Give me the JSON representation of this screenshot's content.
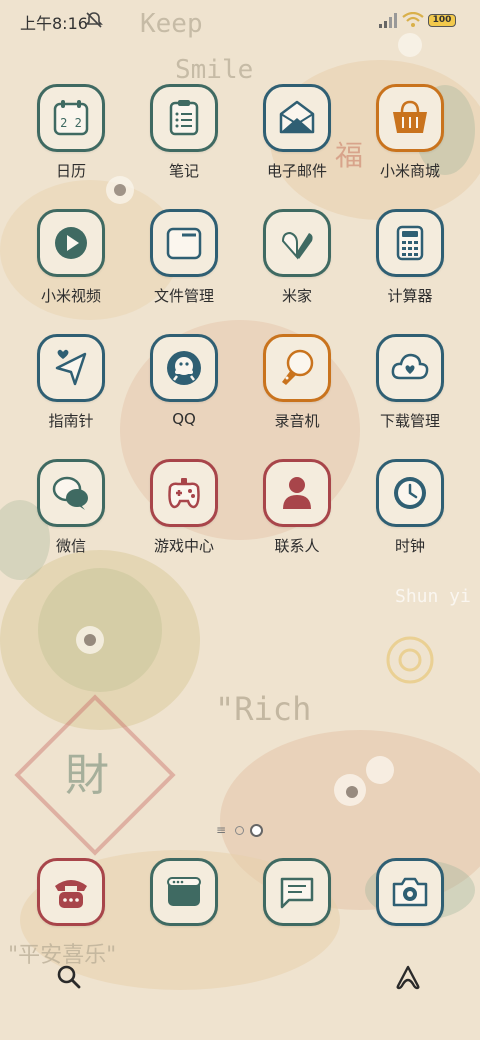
{
  "status_bar": {
    "time": "上午8:16",
    "battery": "100"
  },
  "apps": [
    {
      "label": "日历",
      "icon": "calendar-icon",
      "glyph": "2 2"
    },
    {
      "label": "笔记",
      "icon": "notes-icon"
    },
    {
      "label": "电子邮件",
      "icon": "mail-icon"
    },
    {
      "label": "小米商城",
      "icon": "shopping-basket-icon"
    },
    {
      "label": "小米视频",
      "icon": "play-icon"
    },
    {
      "label": "文件管理",
      "icon": "folder-icon"
    },
    {
      "label": "米家",
      "icon": "smart-home-icon"
    },
    {
      "label": "计算器",
      "icon": "calculator-icon"
    },
    {
      "label": "指南针",
      "icon": "compass-icon"
    },
    {
      "label": "QQ",
      "icon": "qq-icon"
    },
    {
      "label": "录音机",
      "icon": "recorder-icon"
    },
    {
      "label": "下载管理",
      "icon": "cloud-download-icon"
    },
    {
      "label": "微信",
      "icon": "wechat-icon"
    },
    {
      "label": "游戏中心",
      "icon": "gamepad-icon"
    },
    {
      "label": "联系人",
      "icon": "contact-icon"
    },
    {
      "label": "时钟",
      "icon": "clock-icon"
    }
  ],
  "dock": [
    {
      "icon": "phone-icon"
    },
    {
      "icon": "browser-icon"
    },
    {
      "icon": "message-icon"
    },
    {
      "icon": "camera-icon"
    }
  ],
  "page_indicator": {
    "pages": 2,
    "current": 2
  },
  "wallpaper_text": {
    "keep": "Keep",
    "smile": "Smile",
    "rich": "\"Rich",
    "shunyi": "Shun yi",
    "peace": "\"平安喜乐\"",
    "fu": "福",
    "cai": "財"
  },
  "colors": {
    "background": "#efe3cf",
    "icon_bg": "#f4ecdd",
    "green": "#3f6a62",
    "orange": "#c9731d",
    "red": "#a8454a",
    "blue": "#2f5f73"
  }
}
